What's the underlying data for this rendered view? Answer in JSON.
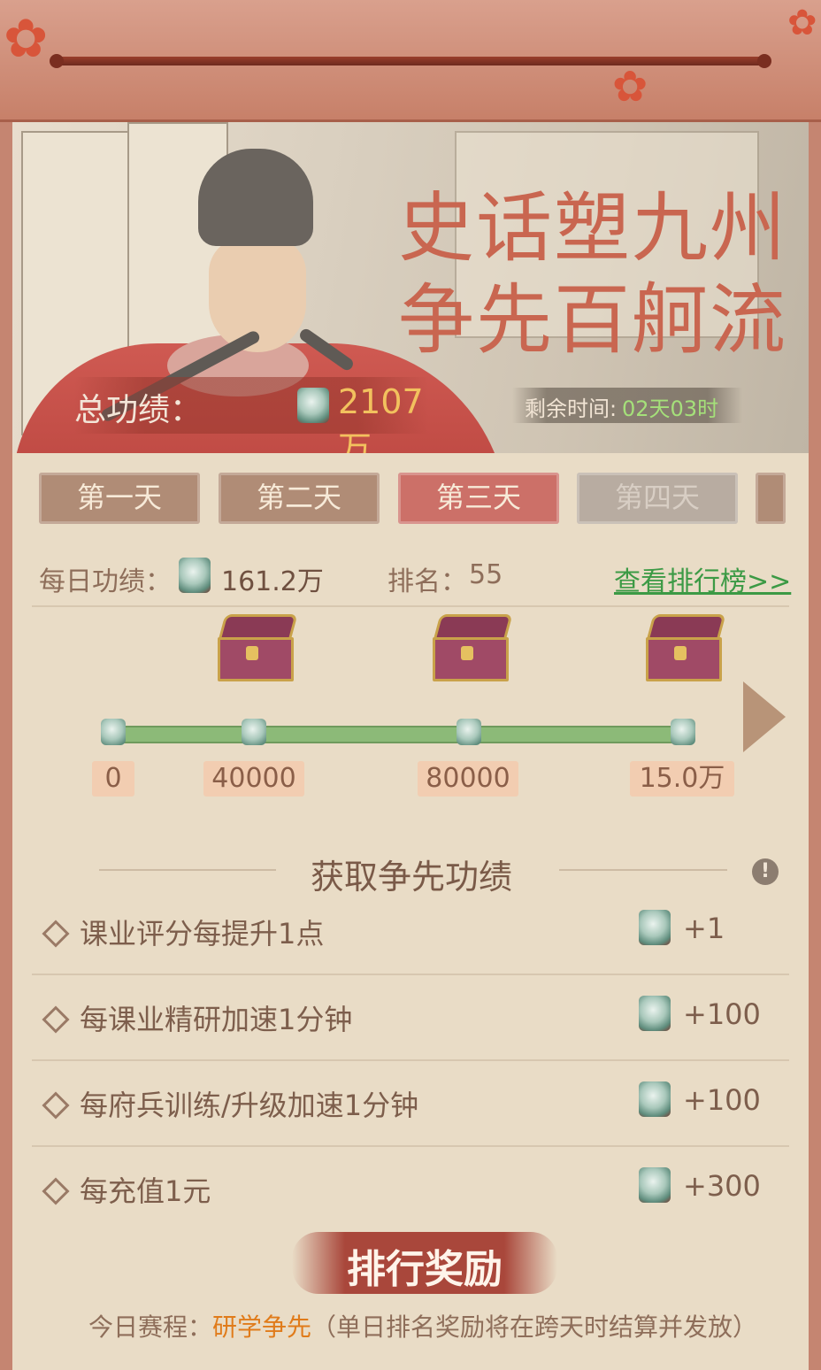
{
  "banner": {
    "title_line1": "史话塑九州",
    "title_line2": "争先百舸流",
    "total_label": "总功绩：",
    "total_value": "2107万",
    "remain_label": "剩余时间:",
    "remain_value": "02天03时"
  },
  "tabs": [
    {
      "label": "第一天",
      "state": "done"
    },
    {
      "label": "第二天",
      "state": "done"
    },
    {
      "label": "第三天",
      "state": "active"
    },
    {
      "label": "第四天",
      "state": "locked"
    }
  ],
  "daily": {
    "label": "每日功绩：",
    "value": "161.2万",
    "rank_label": "排名：",
    "rank_value": "55",
    "leaderboard_link": "查看排行榜>>"
  },
  "milestones": {
    "labels": [
      "0",
      "40000",
      "80000",
      "15.0万"
    ],
    "progress_fraction": 1.0
  },
  "earn": {
    "title": "获取争先功绩",
    "items": [
      {
        "text": "课业评分每提升1点",
        "value": "+1"
      },
      {
        "text": "每课业精研加速1分钟",
        "value": "+100"
      },
      {
        "text": "每府兵训练/升级加速1分钟",
        "value": "+100"
      },
      {
        "text": "每充值1元",
        "value": "+300"
      }
    ]
  },
  "rank_reward": {
    "title": "排行奖励",
    "footer_prefix": "今日赛程：",
    "footer_highlight": "研学争先",
    "footer_note": "（单日排名奖励将在跨天时结算并发放）"
  },
  "colors": {
    "active_tab": "#cc7068",
    "done_tab": "#b08c76",
    "locked_tab": "#b8aca1",
    "progress": "#8cba78",
    "link": "#3c9a45",
    "highlight": "#e07b1a"
  }
}
